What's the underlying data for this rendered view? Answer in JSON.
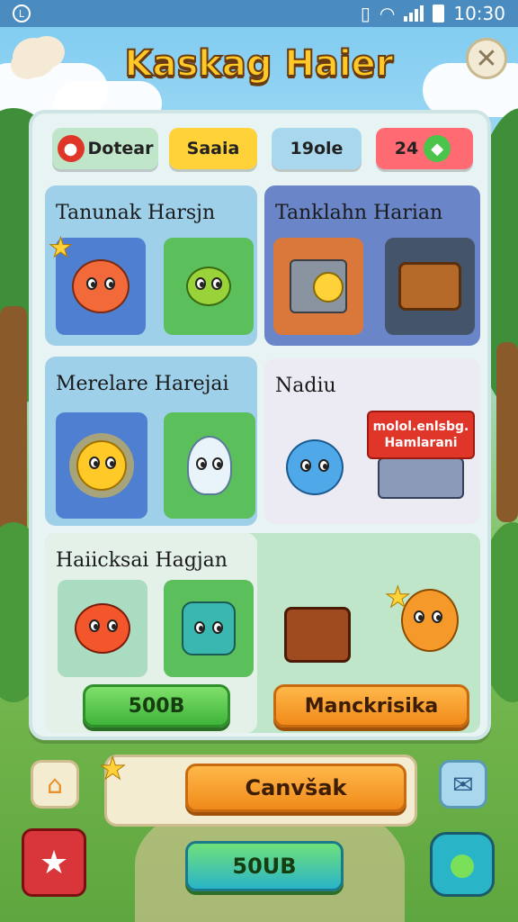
{
  "status_bar": {
    "time": "10:30",
    "left_icon": "L"
  },
  "title": "Kaskag Haier",
  "top_chips": [
    {
      "label": "Dotear",
      "bg": "#bfe6c9"
    },
    {
      "label": "Saaia",
      "bg": "#ffd23a"
    },
    {
      "label": "19ole",
      "bg": "#a9d8ee"
    },
    {
      "label": "24",
      "bg": "#ff6a73"
    }
  ],
  "sections": {
    "s1": {
      "title": "Tanunak Harsjn"
    },
    "s2": {
      "title": "Tanklahn Harian"
    },
    "s3": {
      "title": "Merelare Harejai"
    },
    "s4": {
      "title": "Nadiu",
      "badge_line1": "molol.enlsbg.",
      "badge_line2": "Hamlarani"
    },
    "s5": {
      "title": "Haiicksai Hagjan",
      "green_button": "500B",
      "orange_button": "Manckrisika"
    }
  },
  "bottom": {
    "main_button": "Canvšak",
    "play_button": "50UB"
  },
  "colors": {
    "panel": "#e8f3f4",
    "accent_green": "#3fb43a",
    "accent_orange": "#f08a1a"
  }
}
